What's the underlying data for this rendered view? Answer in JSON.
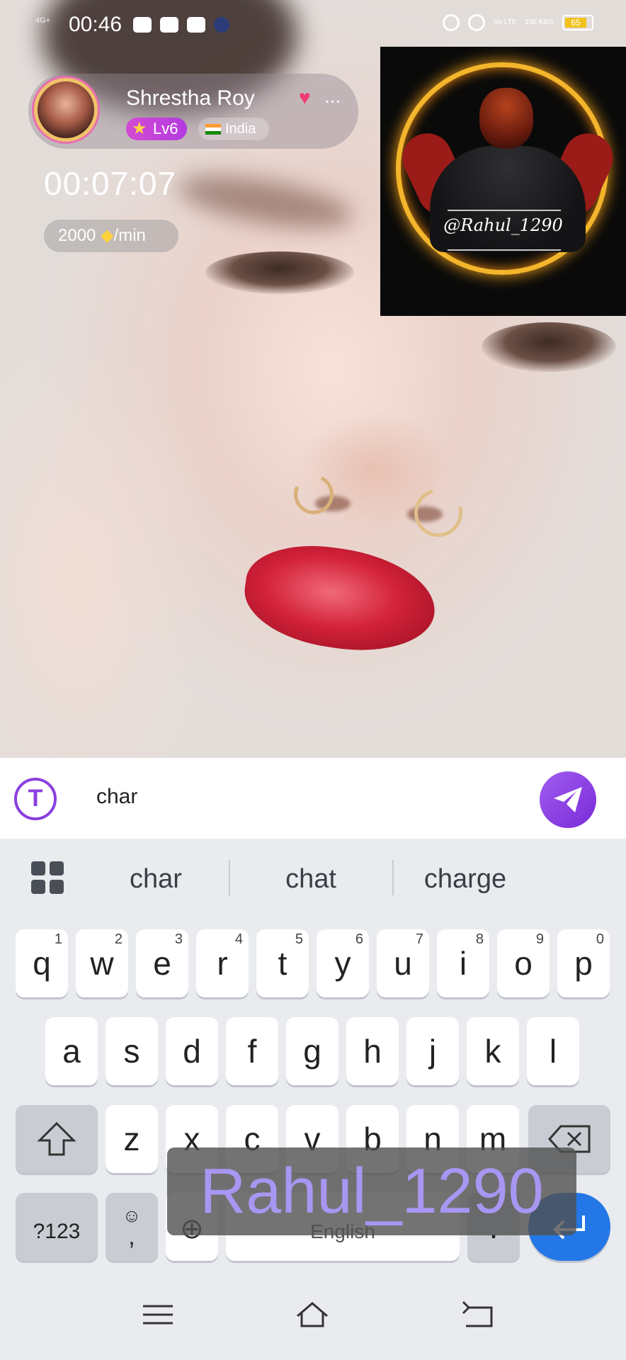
{
  "status_bar": {
    "network": "4G+",
    "time": "00:46",
    "volte": "Vo LTE",
    "speed": "236 KB/s",
    "battery": "65"
  },
  "host": {
    "name": "Shrestha Roy",
    "ellipsis": "...",
    "level": "Lv6",
    "country": "India"
  },
  "call": {
    "timer": "00:07:07",
    "rate_value": "2000",
    "rate_unit": "/min"
  },
  "self_view": {
    "handle": "@Rahul_1290"
  },
  "message": {
    "text": "char"
  },
  "suggestions": [
    "char",
    "chat",
    "charge"
  ],
  "keyboard": {
    "row1": [
      {
        "k": "q",
        "h": "1"
      },
      {
        "k": "w",
        "h": "2"
      },
      {
        "k": "e",
        "h": "3"
      },
      {
        "k": "r",
        "h": "4"
      },
      {
        "k": "t",
        "h": "5"
      },
      {
        "k": "y",
        "h": "6"
      },
      {
        "k": "u",
        "h": "7"
      },
      {
        "k": "i",
        "h": "8"
      },
      {
        "k": "o",
        "h": "9"
      },
      {
        "k": "p",
        "h": "0"
      }
    ],
    "row2": [
      "a",
      "s",
      "d",
      "f",
      "g",
      "h",
      "j",
      "k",
      "l"
    ],
    "row3": [
      "z",
      "x",
      "c",
      "v",
      "b",
      "n",
      "m"
    ],
    "symbols_label": "?123",
    "emoji_comma": ",",
    "space_label": "English",
    "period": "."
  },
  "watermark": "Rahul_1290",
  "colors": {
    "accent_purple": "#8a3fe0",
    "enter_blue": "#2477e6",
    "pip_ring": "#f3b52b"
  }
}
